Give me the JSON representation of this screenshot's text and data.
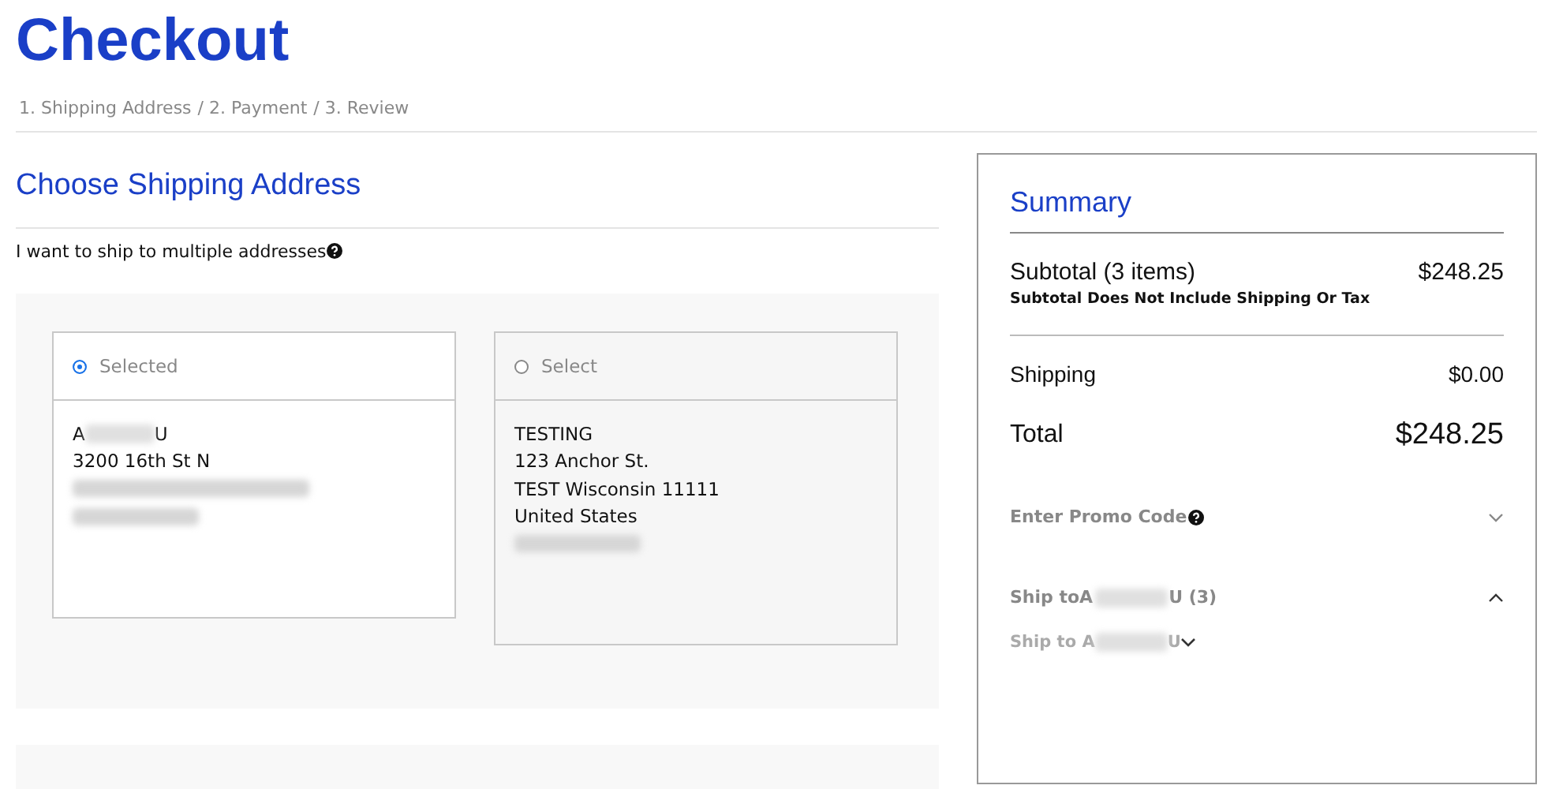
{
  "page_title": "Checkout",
  "steps": [
    "1. Shipping Address",
    "/ 2. Payment",
    "/ 3. Review"
  ],
  "section_title": "Choose Shipping Address",
  "multiple_addresses_label": "I want to ship to multiple addresses",
  "addresses": [
    {
      "selected": true,
      "label": "Selected",
      "name_start": "A",
      "name_end": "U",
      "lines": [
        {
          "kind": "text",
          "text": "3200 16th St N"
        },
        {
          "kind": "redacted"
        },
        {
          "kind": "redacted"
        }
      ]
    },
    {
      "selected": false,
      "label": "Select",
      "lines": [
        {
          "kind": "text",
          "text": "TESTING"
        },
        {
          "kind": "text",
          "text": "123 Anchor St."
        },
        {
          "kind": "text",
          "text": "TEST Wisconsin 11111"
        },
        {
          "kind": "text",
          "text": "United States"
        },
        {
          "kind": "redacted"
        }
      ]
    }
  ],
  "summary": {
    "title": "Summary",
    "subtotal_label": "Subtotal (3 items)",
    "subtotal_value": "$248.25",
    "subtotal_note": "Subtotal Does Not Include Shipping Or Tax",
    "shipping_label": "Shipping",
    "shipping_value": "$0.00",
    "total_label": "Total",
    "total_value": "$248.25",
    "promo": {
      "label": "Enter Promo Code",
      "expanded": false
    },
    "ship_to": {
      "label": "Ship toA",
      "name_end": "U (3)",
      "expanded": true
    },
    "ship_to_item": {
      "label": "Ship to A",
      "name_end": "U",
      "expanded": false
    }
  }
}
